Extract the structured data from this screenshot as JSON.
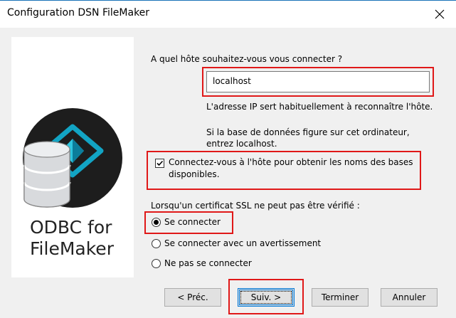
{
  "window": {
    "title": "Configuration DSN FileMaker"
  },
  "logo": {
    "line1": "ODBC for",
    "line2": "FileMaker"
  },
  "host": {
    "question": "A quel hôte souhaitez-vous vous connecter ?",
    "value": "localhost",
    "hint1": "L'adresse IP sert habituellement à reconnaître l'hôte.",
    "hint2_line1": "Si la base de données figure sur cet ordinateur,",
    "hint2_line2": "entrez localhost."
  },
  "connect_checkbox": {
    "line1": "Connectez-vous à l'hôte pour obtenir les noms des bases",
    "line2": "disponibles.",
    "checked": true
  },
  "ssl": {
    "label": "Lorsqu'un certificat SSL ne peut pas être vérifié :",
    "options": [
      "Se connecter",
      "Se connecter avec un avertissement",
      "Ne pas se connecter"
    ],
    "selected": "Se connecter"
  },
  "buttons": {
    "back": "< Préc.",
    "next": "Suiv. >",
    "finish": "Terminer",
    "cancel": "Annuler"
  },
  "colors": {
    "highlight": "#e01818",
    "accent": "#0078d7"
  }
}
